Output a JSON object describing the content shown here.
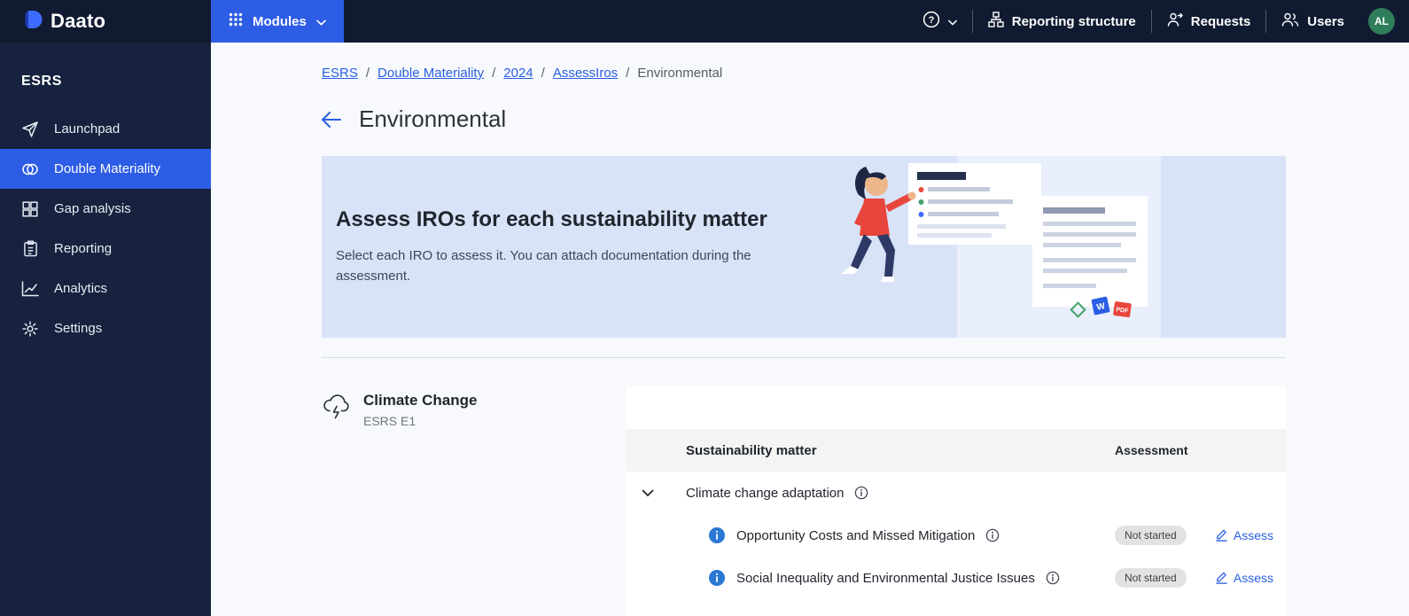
{
  "topbar": {
    "brand": "Daato",
    "modules_label": "Modules",
    "nav": [
      {
        "label": "Reporting structure"
      },
      {
        "label": "Requests"
      },
      {
        "label": "Users"
      }
    ],
    "avatar": "AL"
  },
  "sidebar": {
    "section": "ESRS",
    "items": [
      {
        "label": "Launchpad"
      },
      {
        "label": "Double Materiality"
      },
      {
        "label": "Gap analysis"
      },
      {
        "label": "Reporting"
      },
      {
        "label": "Analytics"
      },
      {
        "label": "Settings"
      }
    ]
  },
  "breadcrumb": {
    "separator": "/",
    "items": [
      {
        "label": "ESRS"
      },
      {
        "label": "Double Materiality"
      },
      {
        "label": "2024"
      },
      {
        "label": "AssessIros"
      },
      {
        "label": "Environmental"
      }
    ]
  },
  "page": {
    "title": "Environmental"
  },
  "banner": {
    "title": "Assess IROs for each sustainability matter",
    "subtitle": "Select each IRO to assess it. You can attach documentation during the assessment."
  },
  "section": {
    "title": "Climate Change",
    "code": "ESRS E1"
  },
  "table": {
    "columns": [
      "Sustainability matter",
      "Assessment"
    ],
    "groups": [
      {
        "label": "Climate change adaptation",
        "rows": [
          {
            "label": "Opportunity Costs and Missed Mitigation",
            "status": "Not started",
            "action": "Assess"
          },
          {
            "label": "Social Inequality and Environmental Justice Issues",
            "status": "Not started",
            "action": "Assess"
          }
        ]
      }
    ]
  },
  "colors": {
    "accent": "#2d5ce5",
    "link": "#2a5fe3",
    "topbar_bg": "#101a30",
    "sidebar_bg": "#16223e",
    "banner_bg": "#d9e3f8",
    "status_badge_bg": "#e2e2e2",
    "avatar_bg": "#2e7d5b"
  }
}
